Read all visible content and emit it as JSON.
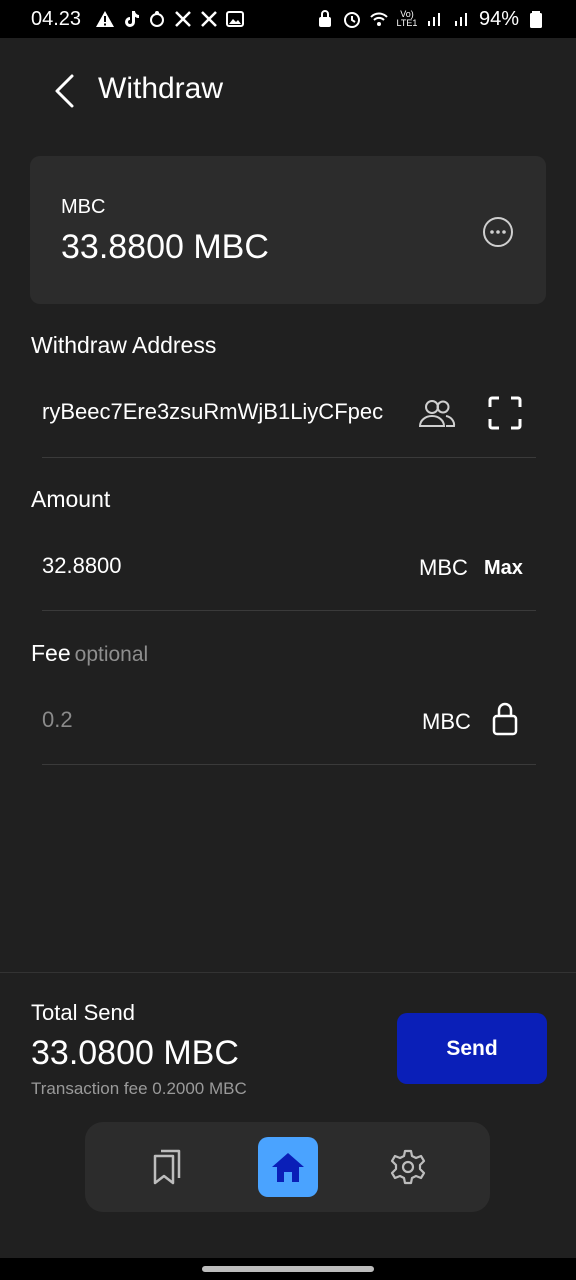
{
  "status_bar": {
    "time": "04.23",
    "battery": "94%",
    "network": "Vo) LTE1"
  },
  "header": {
    "title": "Withdraw"
  },
  "balance_card": {
    "token": "MBC",
    "balance": "33.8800 MBC"
  },
  "withdraw_address": {
    "label": "Withdraw Address",
    "value": "ryBeec7Ere3zsuRmWjB1LiyCFpec"
  },
  "amount": {
    "label": "Amount",
    "value": "32.8800",
    "unit": "MBC",
    "max_label": "Max"
  },
  "fee": {
    "label": "Fee",
    "optional_label": "optional",
    "placeholder": "0.2",
    "unit": "MBC"
  },
  "summary": {
    "total_label": "Total Send",
    "total_value": "33.0800 MBC",
    "tx_fee": "Transaction fee 0.2000 MBC",
    "send_label": "Send"
  },
  "nav": {
    "items": [
      {
        "icon": "bookmarks-icon"
      },
      {
        "icon": "home-icon",
        "active": true
      },
      {
        "icon": "gear-icon"
      }
    ]
  },
  "colors": {
    "background": "#202020",
    "card": "#2c2c2c",
    "send_button": "#0a1fb8",
    "nav_active": "#4aa3ff"
  }
}
